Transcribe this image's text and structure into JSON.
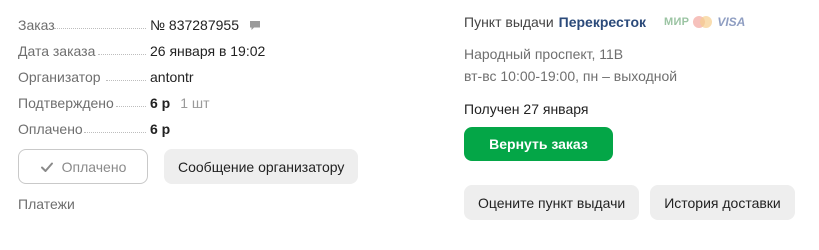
{
  "order": {
    "fields": [
      {
        "label": "Заказ",
        "value": "№ 837287955"
      },
      {
        "label": "Дата заказа",
        "value": "26 января в 19:02"
      },
      {
        "label": "Организатор",
        "value": "antontr"
      },
      {
        "label": "Подтверждено",
        "value": "6 р",
        "qty": "1 шт"
      },
      {
        "label": "Оплачено",
        "value": "6 р"
      }
    ],
    "paid_button": "Оплачено",
    "message_button": "Сообщение организатору",
    "payments_link": "Платежи"
  },
  "pickup": {
    "label": "Пункт выдачи",
    "partner": "Перекресток",
    "payment_logos": {
      "mir": "МИР",
      "visa": "VISA"
    },
    "address": "Народный проспект, 11В",
    "hours": "вт-вс 10:00-19:00, пн – выходной",
    "received": "Получен 27 января",
    "return_button": "Вернуть заказ",
    "rate_button": "Оцените пункт выдачи",
    "history_button": "История доставки"
  },
  "colors": {
    "accent_green": "#04a647",
    "partner_blue": "#2b4a7a"
  }
}
